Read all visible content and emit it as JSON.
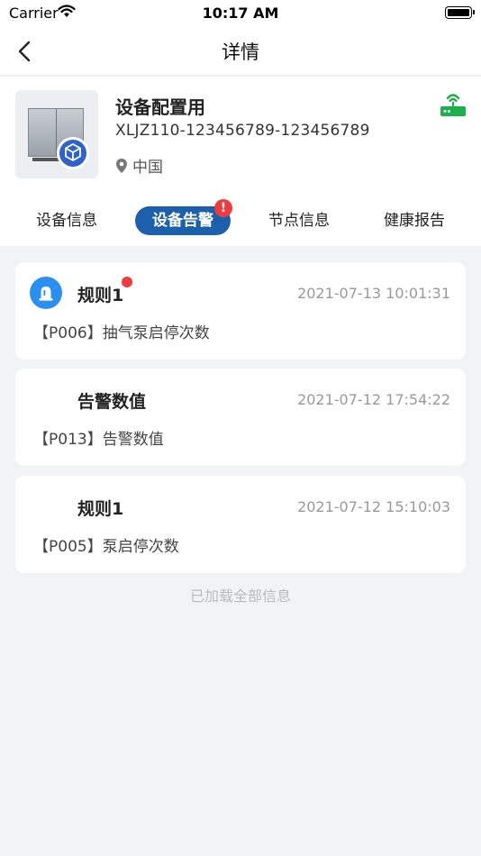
{
  "status_bar": {
    "carrier": "Carrier",
    "time": "10:17 AM"
  },
  "nav": {
    "title": "详情"
  },
  "device": {
    "name": "设备配置用",
    "id": "XLJZ110-123456789-123456789",
    "location": "中国",
    "online_color": "#18b14a"
  },
  "tabs": [
    {
      "label": "设备信息",
      "active": false
    },
    {
      "label": "设备告警",
      "active": true,
      "badge": "!"
    },
    {
      "label": "节点信息",
      "active": false
    },
    {
      "label": "健康报告",
      "active": false
    }
  ],
  "alarms": [
    {
      "rule": "规则1",
      "time": "2021-07-13 10:01:31",
      "desc": "【P006】抽气泵启停次数",
      "unread": true
    },
    {
      "rule": "告警数值",
      "time": "2021-07-12 17:54:22",
      "desc": "【P013】告警数值",
      "unread": false
    },
    {
      "rule": "规则1",
      "time": "2021-07-12 15:10:03",
      "desc": "【P005】泵启停次数",
      "unread": false
    }
  ],
  "footer": {
    "loaded_text": "已加载全部信息"
  },
  "colors": {
    "accent": "#1b5fad",
    "alert": "#ef3b3b",
    "avatar": "#2a8ff2"
  }
}
